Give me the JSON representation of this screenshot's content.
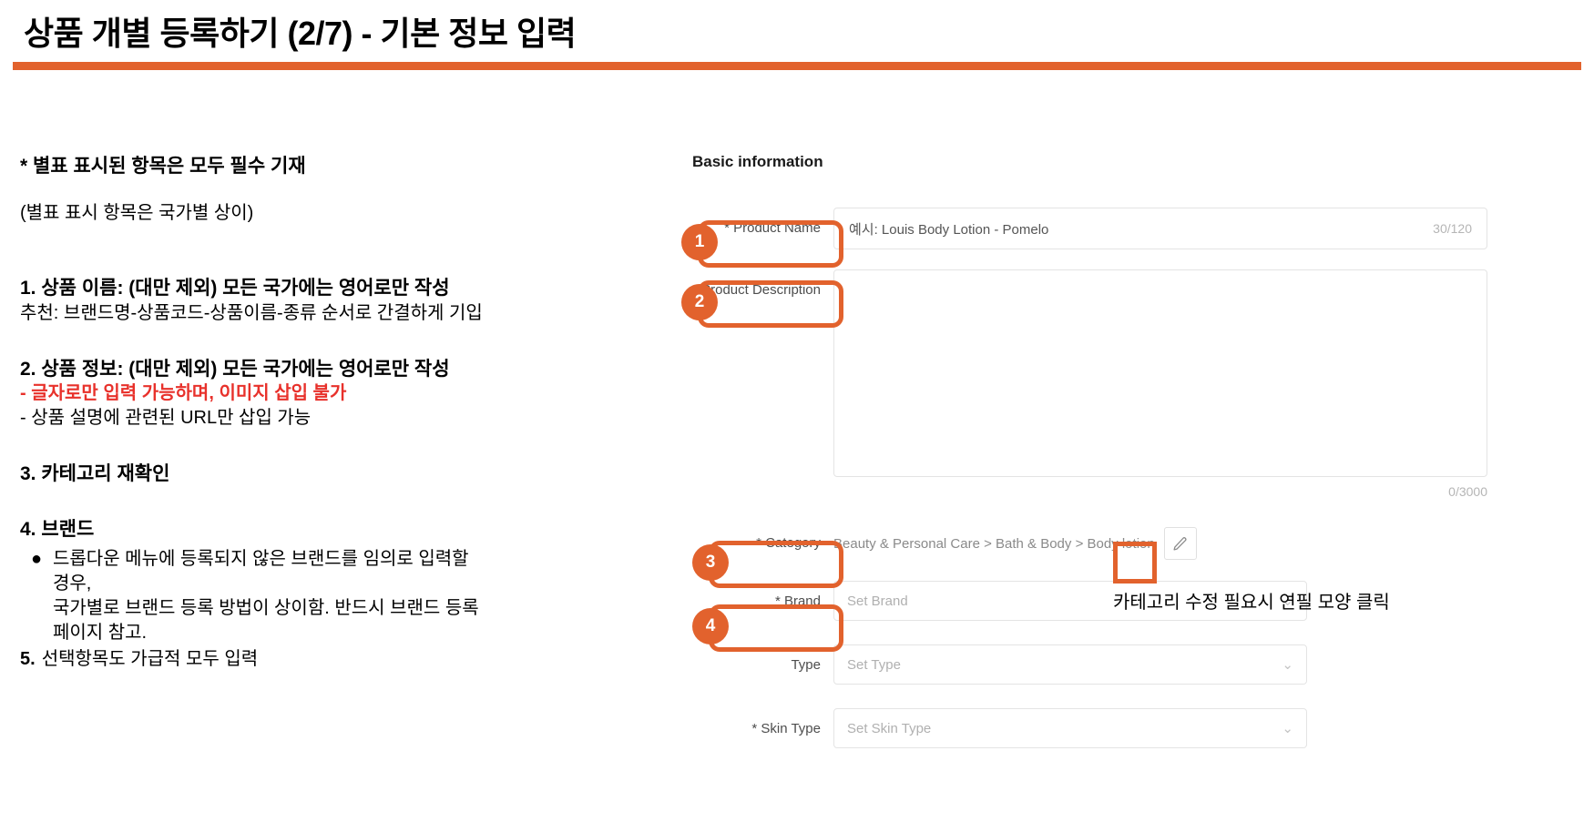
{
  "header": {
    "title": "상품 개별 등록하기 (2/7) - 기본 정보 입력",
    "rule_color": "#E2622D"
  },
  "left_panel": {
    "note_required": "* 별표 표시된 항목은 모두 필수 기재",
    "note_varies": "(별표 표시 항목은 국가별 상이)",
    "section1_head": "1. 상품 이름: (대만 제외) 모든 국가에는 영어로만 작성",
    "section1_sub": "추천: 브랜드명-상품코드-상품이름-종류 순서로 간결하게 기입",
    "section2_head": "2. 상품 정보: (대만 제외) 모든 국가에는 영어로만 작성",
    "section2_sub_red": "- 글자로만 입력 가능하며, 이미지 삽입 불가",
    "section2_sub2": "- 상품 설명에 관련된 URL만 삽입 가능",
    "section3_head": "3. 카테고리 재확인",
    "section4_head": "4. 브랜드",
    "section4_bullet": "드롭다운 메뉴에 등록되지 않은 브랜드를 임의로 입력할\n경우,\n국가별로 브랜드 등록 방법이 상이함. 반드시 브랜드 등록\n페이지 참고.",
    "section5_num": "5.",
    "section5_text": "선택항목도 가급적 모두 입력"
  },
  "form": {
    "section_title": "Basic information",
    "product_name": {
      "label": "* Product Name",
      "placeholder": "예시: Louis Body Lotion - Pomelo",
      "counter": "30/120"
    },
    "product_description": {
      "label": "* Product Description",
      "value": "",
      "counter": "0/3000"
    },
    "category": {
      "label": "* Category",
      "value": "Beauty & Personal Care > Bath & Body > Body lotion",
      "edit_icon": "pencil-icon"
    },
    "brand": {
      "label": "* Brand",
      "placeholder": "Set Brand",
      "chevron": "⌄"
    },
    "type": {
      "label": "Type",
      "placeholder": "Set Type",
      "chevron": "⌄"
    },
    "skin_type": {
      "label": "* Skin Type",
      "placeholder": "Set Skin Type",
      "chevron": "⌄"
    }
  },
  "annotations": {
    "badge1": "1",
    "badge2": "2",
    "badge3": "3",
    "badge4": "4",
    "pencil_note": "카테고리 수정 필요시 연필 모양 클릭",
    "accent_color": "#E2622D",
    "warning_color": "#E8312B"
  }
}
